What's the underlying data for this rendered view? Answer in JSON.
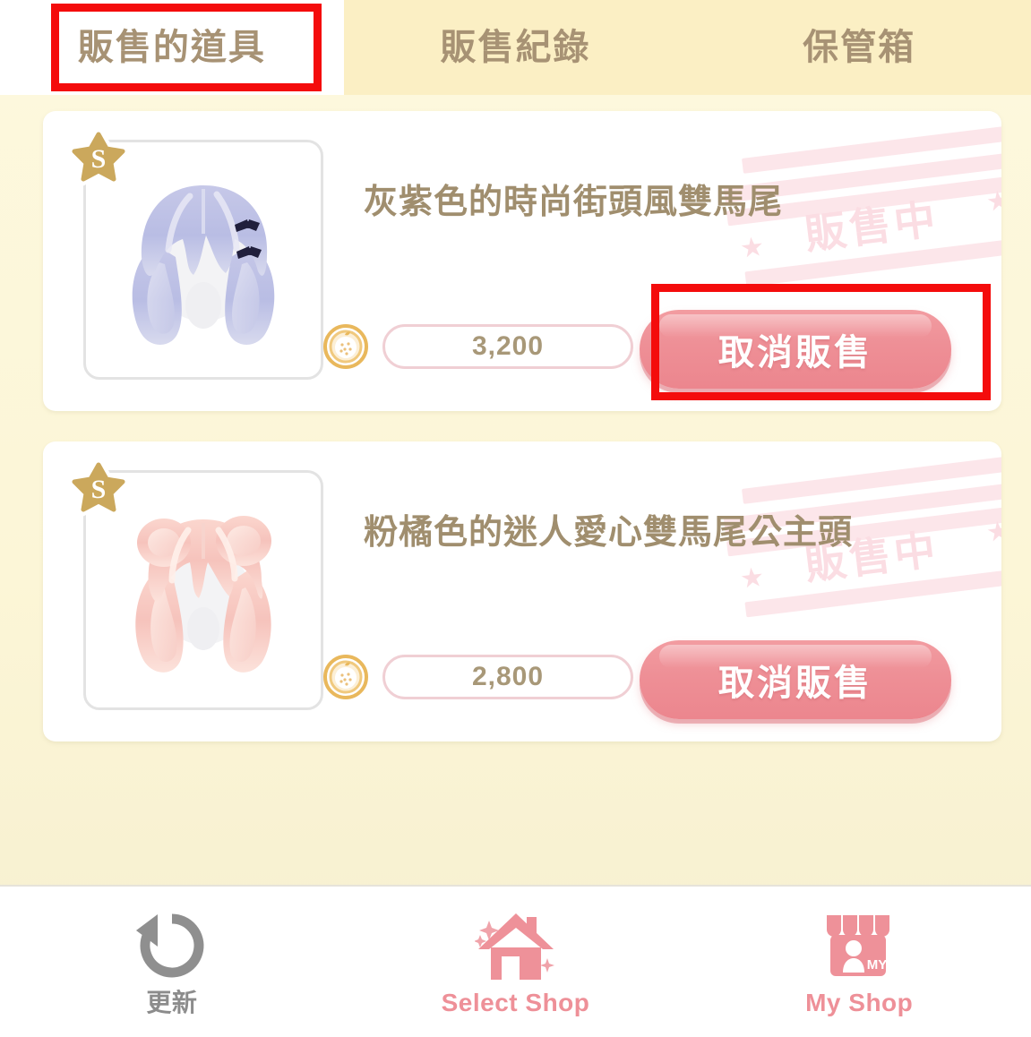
{
  "tabs": [
    {
      "label": "販售的道具",
      "active": true,
      "name": "tab-items-for-sale"
    },
    {
      "label": "販售紀錄",
      "active": false,
      "name": "tab-sales-history"
    },
    {
      "label": "保管箱",
      "active": false,
      "name": "tab-storage-box"
    }
  ],
  "items": [
    {
      "title": "灰紫色的時尚街頭風雙馬尾",
      "price": "3,200",
      "rarity": "S",
      "status_stamp": "販售中",
      "button_label": "取消販售",
      "thumb_kind": "lavender-twintails-hair",
      "coin_icon": "strawberry-coin-icon"
    },
    {
      "title": "粉橘色的迷人愛心雙馬尾公主頭",
      "price": "2,800",
      "rarity": "S",
      "status_stamp": "販售中",
      "button_label": "取消販售",
      "thumb_kind": "pink-buns-twintails-hair",
      "coin_icon": "strawberry-coin-icon"
    }
  ],
  "bottom_nav": [
    {
      "label": "更新",
      "icon": "refresh-icon",
      "tone": "gray",
      "name": "nav-refresh"
    },
    {
      "label": "Select Shop",
      "icon": "house-icon",
      "tone": "pink",
      "name": "nav-select-shop"
    },
    {
      "label": "My Shop",
      "icon": "storefront-icon",
      "tone": "pink",
      "name": "nav-my-shop"
    }
  ],
  "colors": {
    "page_bg": "#FDF8DE",
    "tab_inactive_bg": "#FBEFC4",
    "tab_active_bg": "#FFFFFF",
    "tab_text": "#A79274",
    "title_text": "#A08E6E",
    "button_pink": "#EE8F96",
    "stamp_pink": "#FBDDE3",
    "annotation_red": "#F40C0C",
    "rarity_gold": "#C9A košice"
  }
}
